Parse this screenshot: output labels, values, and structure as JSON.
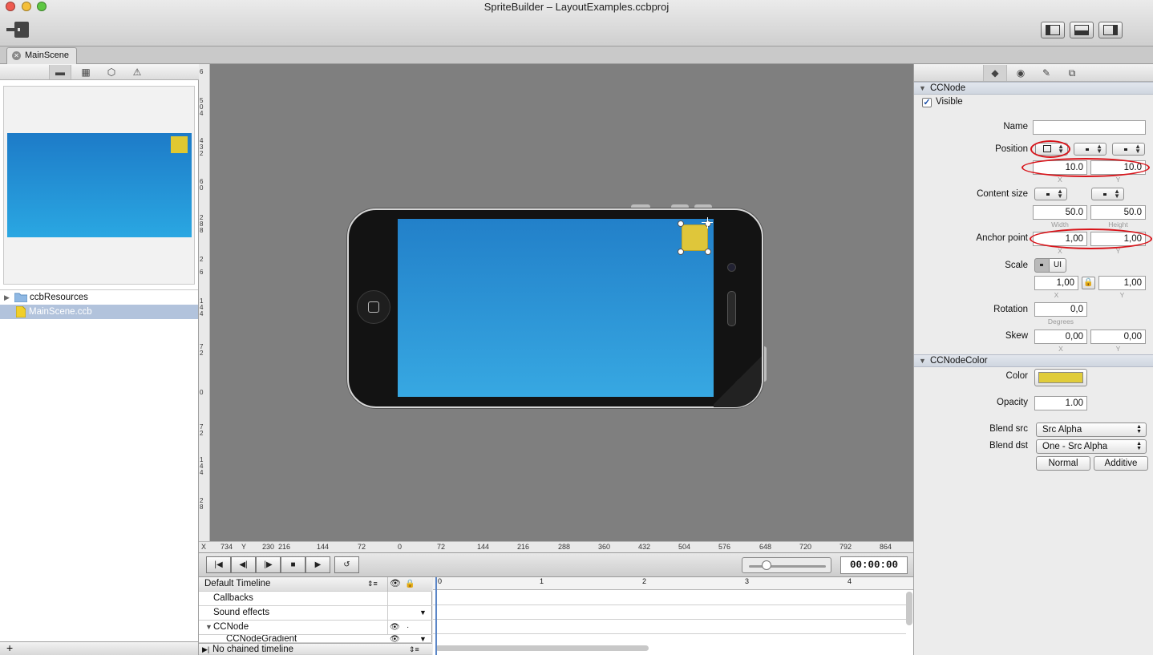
{
  "window": {
    "title": "SpriteBuilder – LayoutExamples.ccbproj"
  },
  "tabs": [
    {
      "label": "MainScene"
    }
  ],
  "project_tree": [
    {
      "label": "ccbResources",
      "type": "folder"
    },
    {
      "label": "MainScene.ccb",
      "type": "file",
      "selected": true
    }
  ],
  "vruler_labels": [
    "6",
    "5",
    "0",
    "4",
    "4",
    "3",
    "2",
    "6",
    "0",
    "2",
    "8",
    "8",
    "2",
    "6",
    "1",
    "4",
    "4",
    "7",
    "2",
    "0",
    "7",
    "2",
    "1",
    "4",
    "4",
    "2",
    "8"
  ],
  "hruler": {
    "x_label": "X",
    "x_value": "734",
    "y_label": "Y",
    "y_value": "230",
    "ticks": [
      "216",
      "144",
      "72",
      "0",
      "72",
      "144",
      "216",
      "288",
      "360",
      "432",
      "504",
      "576",
      "648",
      "720",
      "792",
      "864"
    ]
  },
  "timeline": {
    "timecode": "00:00:00",
    "name": "Default Timeline",
    "rows": [
      "Callbacks",
      "Sound effects",
      "CCNode",
      "CCNodeGradient"
    ],
    "chained": "No chained timeline",
    "ruler": [
      "0",
      "1",
      "2",
      "3",
      "4"
    ]
  },
  "inspector": {
    "ccnode_header": "CCNode",
    "visible_label": "Visible",
    "visible": true,
    "name_label": "Name",
    "name_value": "",
    "position_label": "Position",
    "position_x": "10.0",
    "position_y": "10.0",
    "x_sub": "X",
    "y_sub": "Y",
    "content_size_label": "Content size",
    "content_width": "50.0",
    "content_height": "50.0",
    "width_sub": "Width",
    "height_sub": "Height",
    "anchor_label": "Anchor point",
    "anchor_x": "1,00",
    "anchor_y": "1,00",
    "scale_label": "Scale",
    "scale_ui": "UI",
    "scale_x": "1,00",
    "scale_y": "1,00",
    "rotation_label": "Rotation",
    "rotation": "0,0",
    "degrees_sub": "Degrees",
    "skew_label": "Skew",
    "skew_x": "0,00",
    "skew_y": "0,00",
    "color_header": "CCNodeColor",
    "color_label": "Color",
    "color_value": "#e0cc3a",
    "opacity_label": "Opacity",
    "opacity": "1.00",
    "blend_src_label": "Blend src",
    "blend_src": "Src Alpha",
    "blend_dst_label": "Blend dst",
    "blend_dst": "One - Src Alpha",
    "normal_label": "Normal",
    "additive_label": "Additive"
  },
  "colors": {
    "accent": "#d8141a",
    "node": "#dfc63a",
    "screen_top": "#2280c9",
    "screen_bottom": "#37a8e2"
  }
}
